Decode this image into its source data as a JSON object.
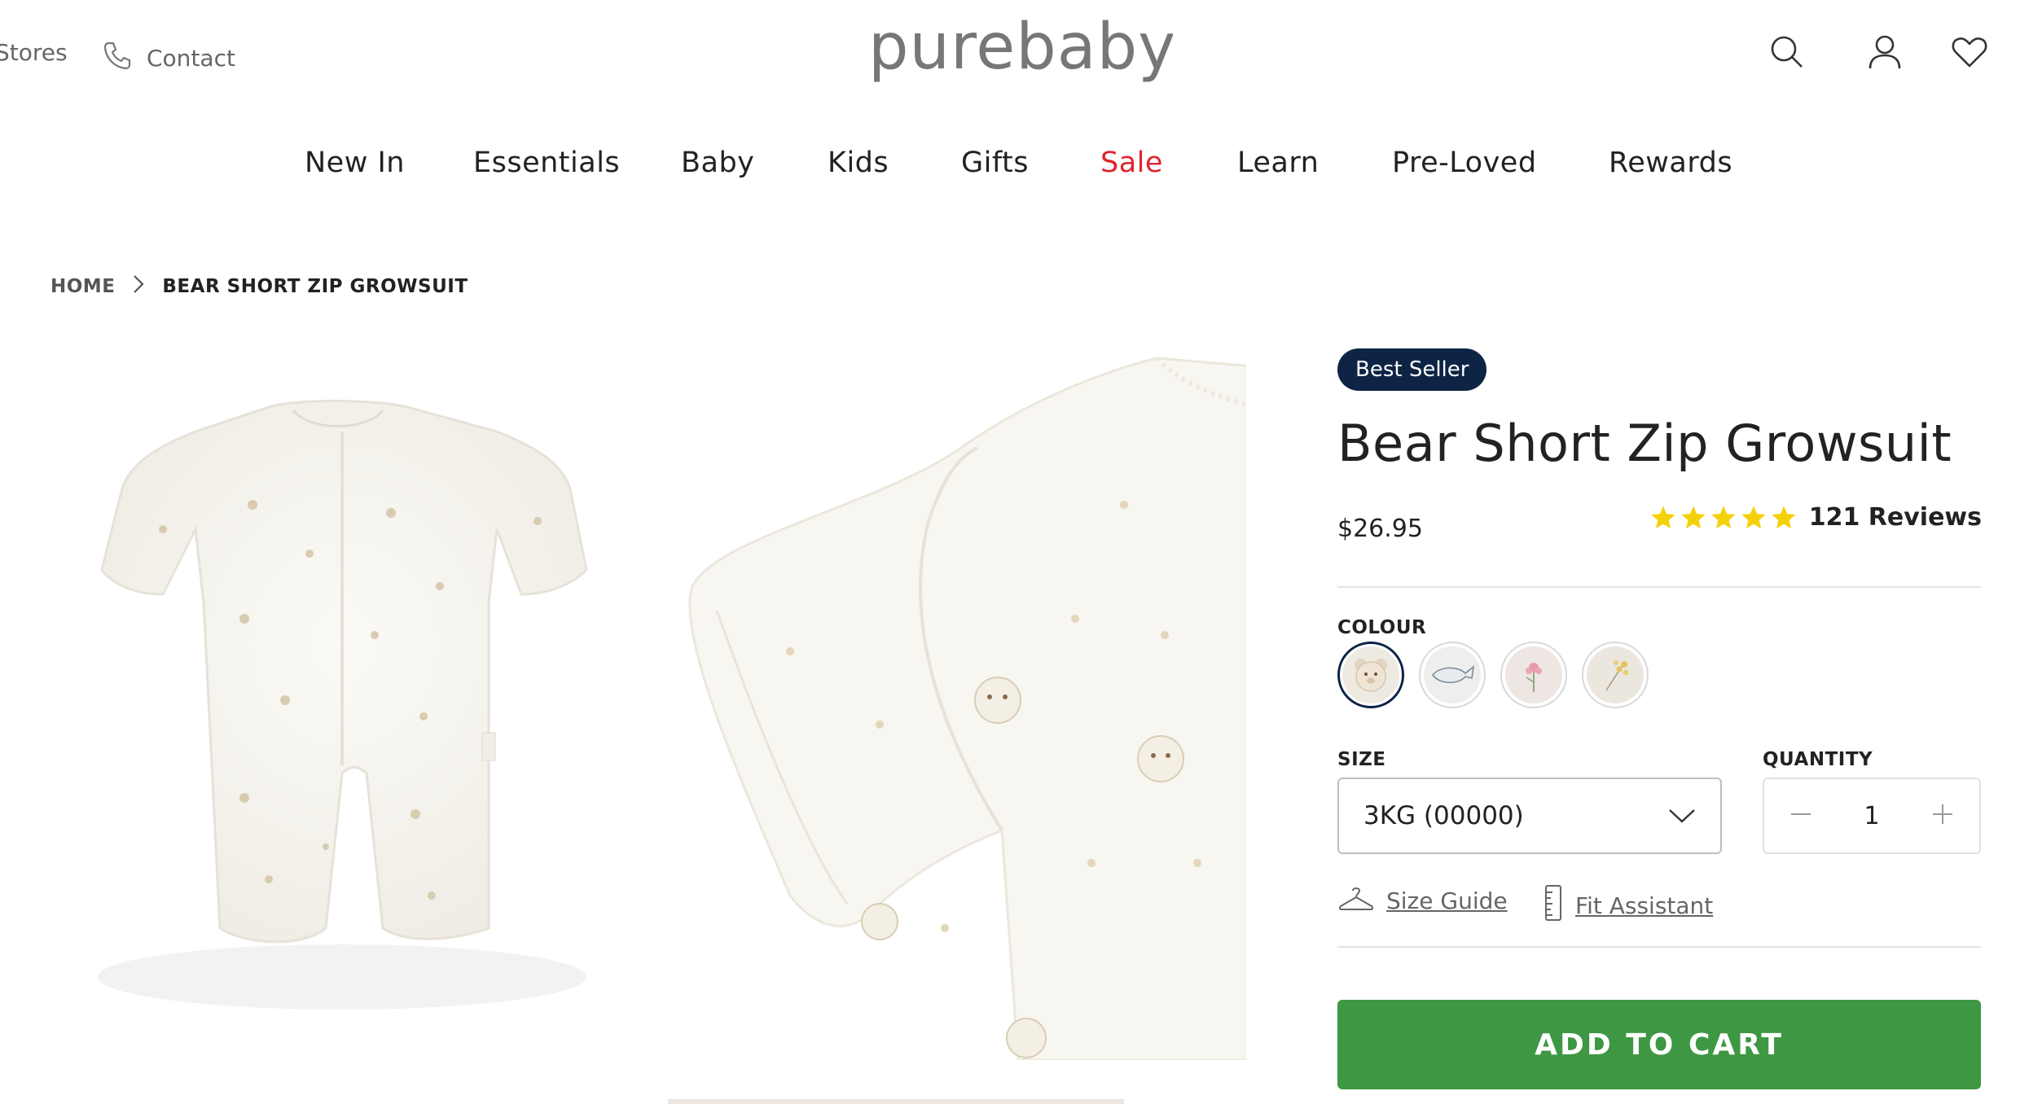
{
  "header": {
    "stores_label": "Stores",
    "contact_label": "Contact",
    "logo_text": "purebaby",
    "icons": [
      "search-icon",
      "user-icon",
      "heart-icon"
    ]
  },
  "nav": {
    "items": [
      {
        "label": "New In"
      },
      {
        "label": "Essentials"
      },
      {
        "label": "Baby"
      },
      {
        "label": "Kids"
      },
      {
        "label": "Gifts"
      },
      {
        "label": "Sale",
        "color": "#e0242e"
      },
      {
        "label": "Learn"
      },
      {
        "label": "Pre-Loved"
      },
      {
        "label": "Rewards"
      }
    ]
  },
  "breadcrumb": {
    "home": "HOME",
    "current": "BEAR SHORT ZIP GROWSUIT"
  },
  "product": {
    "badge": "Best Seller",
    "title": "Bear Short Zip Growsuit",
    "price": "$26.95",
    "rating": 5,
    "reviews_label": "121 Reviews",
    "colour_label": "COLOUR",
    "swatches": [
      {
        "name": "bear",
        "selected": true
      },
      {
        "name": "whale",
        "selected": false
      },
      {
        "name": "pink-flower",
        "selected": false
      },
      {
        "name": "yellow-flower",
        "selected": false
      }
    ],
    "size_label": "SIZE",
    "size_value": "3KG (00000)",
    "quantity_label": "QUANTITY",
    "quantity_value": "1",
    "size_guide_label": "Size Guide",
    "fit_assistant_label": "Fit Assistant",
    "add_to_cart_label": "ADD TO CART"
  },
  "colors": {
    "brand_navy": "#0d2445",
    "cart_green": "#3e9743",
    "sale_red": "#e0242e",
    "star_yellow": "#f5d10a"
  }
}
